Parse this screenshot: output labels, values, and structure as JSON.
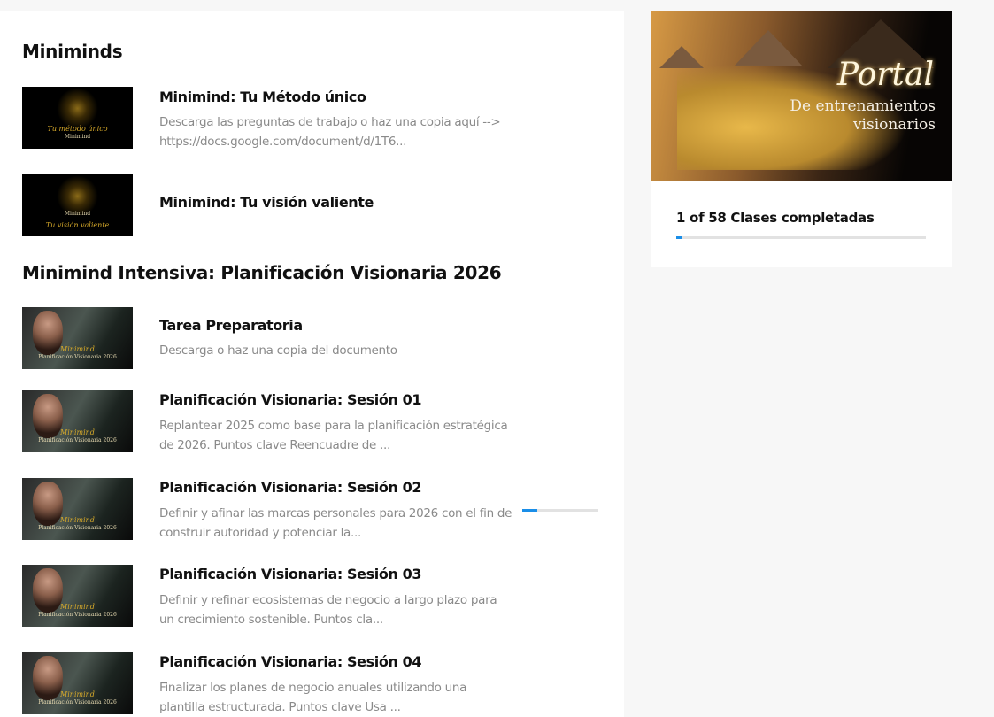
{
  "sections": [
    {
      "title": "Miniminds",
      "lessons": [
        {
          "title": "Minimind: Tu Método único",
          "desc": "Descarga las preguntas de trabajo o haz una copia aquí --> https://docs.google.com/document/d/1T6...",
          "thumb_gold": "Tu método único",
          "thumb_caption": "Minimind"
        },
        {
          "title": "Minimind: Tu visión valiente",
          "desc": "",
          "thumb_gold": "Tu visión valiente",
          "thumb_caption": "Minimind"
        }
      ]
    },
    {
      "title": "Minimind Intensiva: Planificación Visionaria 2026",
      "lessons": [
        {
          "title": "Tarea Preparatoria",
          "desc": "Descarga o haz una copia del documento",
          "thumb_gold": "Minimind",
          "thumb_caption": "Planificación Visionaria 2026"
        },
        {
          "title": "Planificación Visionaria: Sesión 01",
          "desc": "Replantear 2025 como base para la planificación estratégica de 2026. Puntos clave Reencuadre de ...",
          "thumb_gold": "Minimind",
          "thumb_caption": "Planificación Visionaria 2026"
        },
        {
          "title": "Planificación Visionaria: Sesión 02",
          "desc": "Definir y afinar las marcas personales para 2026 con el fin de construir autoridad y potenciar la...",
          "thumb_gold": "Minimind",
          "thumb_caption": "Planificación Visionaria 2026",
          "progress_percent": 20
        },
        {
          "title": "Planificación Visionaria: Sesión 03",
          "desc": "Definir y refinar ecosistemas de negocio a largo plazo para un crecimiento sostenible. Puntos cla...",
          "thumb_gold": "Minimind",
          "thumb_caption": "Planificación Visionaria 2026"
        },
        {
          "title": "Planificación Visionaria: Sesión 04",
          "desc": "Finalizar los planes de negocio anuales utilizando una plantilla estructurada. Puntos clave Usa ...",
          "thumb_gold": "Minimind",
          "thumb_caption": "Planificación Visionaria 2026"
        }
      ]
    }
  ],
  "sidebar": {
    "hero_script": "Portal",
    "hero_subtitle_1": "De entrenamientos",
    "hero_subtitle_2": "visionarios",
    "progress_label": "1 of 58 Clases completadas",
    "completed": 1,
    "total": 58
  },
  "colors": {
    "accent": "#1a8ee8",
    "track": "#e2e2e2"
  }
}
